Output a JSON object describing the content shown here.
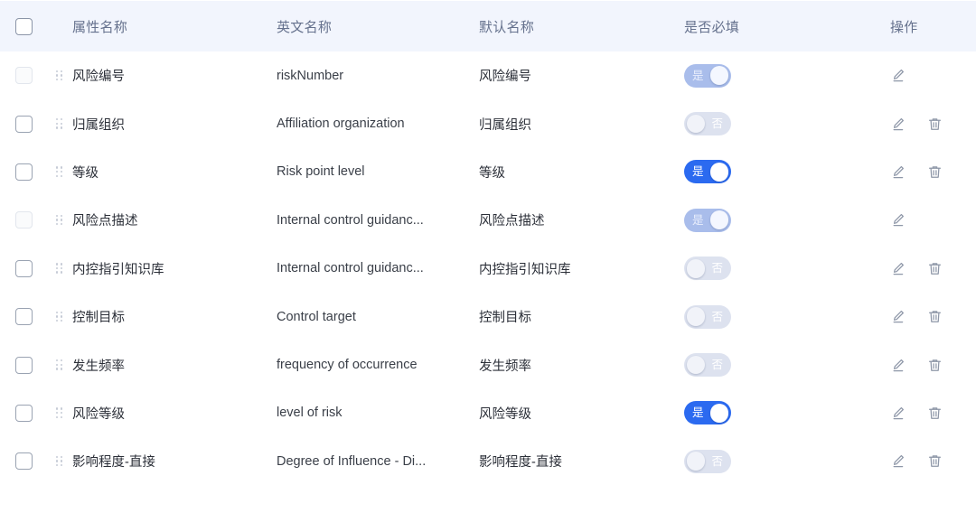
{
  "table": {
    "header": {
      "select_all_checkbox": "",
      "columns": [
        {
          "key": "attr",
          "label": "属性名称"
        },
        {
          "key": "english",
          "label": "英文名称"
        },
        {
          "key": "default",
          "label": "默认名称"
        },
        {
          "key": "required",
          "label": "是否必填"
        },
        {
          "key": "actions",
          "label": "操作"
        }
      ]
    },
    "toggle_labels": {
      "yes": "是",
      "no": "否"
    },
    "icons": {
      "edit": "pencil-icon",
      "delete": "trash-icon",
      "drag": "drag-handle-icon"
    },
    "colors": {
      "header_bg": "#f2f5fd",
      "header_text": "#65718d",
      "toggle_on": "#2b6af0",
      "toggle_on_disabled": "#a9bdeb",
      "toggle_off": "#dde2ef",
      "icon": "#8e97a8",
      "row_text": "#2b2f38"
    },
    "rows": [
      {
        "attr": "风险编号",
        "english": "riskNumber",
        "default": "风险编号",
        "required": "是",
        "required_on": true,
        "disabled": true,
        "can_delete": false
      },
      {
        "attr": "归属组织",
        "english": "Affiliation organization",
        "default": "归属组织",
        "required": "否",
        "required_on": false,
        "disabled": false,
        "can_delete": true
      },
      {
        "attr": "等级",
        "english": "Risk point level",
        "default": "等级",
        "required": "是",
        "required_on": true,
        "disabled": false,
        "can_delete": true
      },
      {
        "attr": "风险点描述",
        "english": "Internal control guidanc...",
        "default": "风险点描述",
        "required": "是",
        "required_on": true,
        "disabled": true,
        "can_delete": false
      },
      {
        "attr": "内控指引知识库",
        "english": "Internal control guidanc...",
        "default": "内控指引知识库",
        "required": "否",
        "required_on": false,
        "disabled": false,
        "can_delete": true
      },
      {
        "attr": "控制目标",
        "english": "Control target",
        "default": "控制目标",
        "required": "否",
        "required_on": false,
        "disabled": false,
        "can_delete": true
      },
      {
        "attr": "发生频率",
        "english": "frequency of occurrence",
        "default": "发生频率",
        "required": "否",
        "required_on": false,
        "disabled": false,
        "can_delete": true
      },
      {
        "attr": "风险等级",
        "english": "level of risk",
        "default": "风险等级",
        "required": "是",
        "required_on": true,
        "disabled": false,
        "can_delete": true
      },
      {
        "attr": "影响程度-直接",
        "english": "Degree of Influence - Di...",
        "default": "影响程度-直接",
        "required": "否",
        "required_on": false,
        "disabled": false,
        "can_delete": true
      }
    ]
  }
}
